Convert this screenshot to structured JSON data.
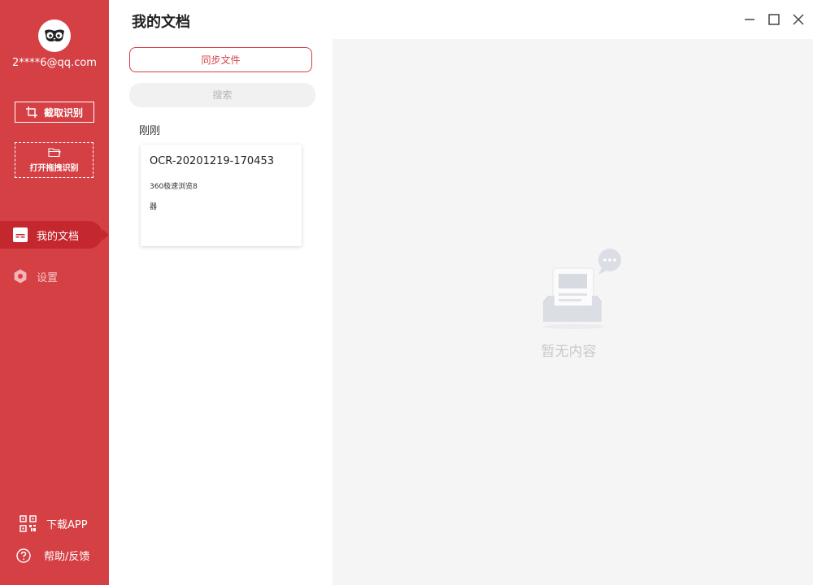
{
  "sidebar": {
    "user_email": "2****6@qq.com",
    "capture_button": "截取识别",
    "open_button": "打开拖拽识别",
    "nav": {
      "my_docs": "我的文档",
      "settings": "设置"
    },
    "download_app": "下载APP",
    "help": "帮助/反馈"
  },
  "header": {
    "title": "我的文档"
  },
  "list": {
    "sync_button": "同步文件",
    "search_placeholder": "搜索",
    "section_label": "刚刚",
    "docs": [
      {
        "title": "OCR-20201219-170453",
        "snippet_line1": "360极速浏览8",
        "snippet_line2": "器"
      }
    ]
  },
  "preview": {
    "empty_text": "暂无内容"
  },
  "colors": {
    "brand_red": "#d54045",
    "active_red": "#c4272d"
  }
}
